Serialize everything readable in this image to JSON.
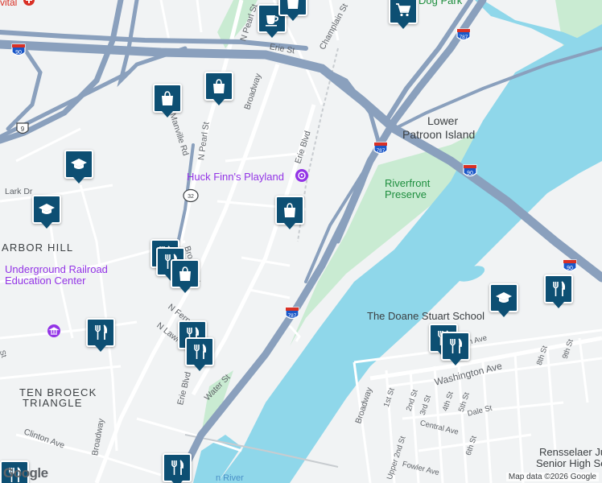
{
  "map": {
    "places": {
      "arbor_hill": "ARBOR HILL",
      "ten_broeck_1": "TEN BROECK",
      "ten_broeck_2": "TRIANGLE",
      "lower_patroon_1": "Lower",
      "lower_patroon_2": "Patroon Island"
    },
    "pois": {
      "huck_finn": "Huck Finn's Playland",
      "underground_1": "Underground Railroad",
      "underground_2": "Education Center",
      "riverfront_1": "Riverfront",
      "riverfront_2": "Preserve",
      "doane_stuart": "The Doane Stuart School",
      "rensselaer_1": "Rensselaer Junio",
      "rensselaer_2": "Senior High Schoo",
      "dog_park": "Dog Park",
      "hudson": "n River",
      "vital": "vital"
    },
    "streets": {
      "broadway_top": "Broadway",
      "broadway_mid": "Broadway",
      "broadway_left": "Broadway",
      "broadway_right": "Broadway",
      "n_pearl_top": "N Pearl St",
      "n_pearl_mid": "N Pearl St",
      "erie_top": "Erie St",
      "erie_blvd": "Erie Blvd",
      "erie_blvd_low": "Erie Blvd",
      "champlain": "Champlain St",
      "manville": "Manville Rd",
      "lark": "Lark Dr",
      "n_ferry": "N Ferry",
      "n_lawrence": "N Lawr",
      "water": "Water St",
      "clinton": "Clinton Ave",
      "washington": "Washington Ave",
      "first": "1st St",
      "second": "2nd St",
      "third": "3rd St",
      "fourth": "4th St",
      "fifth": "5th St",
      "sixth": "6th St",
      "eighth": "8th St",
      "ninth": "9th St",
      "dale": "Dale St",
      "central": "Central Ave",
      "upper_2nd": "Upper 2nd St",
      "fowler": "Fowler Ave",
      "ave_frag": "h Ave",
      "st_frag": "St",
      "broadway_small": "Broadway"
    },
    "shields": {
      "i787_a": "787",
      "i787_b": "787",
      "i787_c": "787",
      "i90_a": "90",
      "i90_b": "90",
      "i90_c": "90",
      "us9": "9",
      "r32": "32"
    },
    "footer": {
      "logo": "Google",
      "attribution": "Map data ©2026 Google"
    }
  },
  "markers": [
    {
      "name": "shopping-marker",
      "icon": "shopping-bag-icon"
    },
    {
      "name": "restaurant-marker",
      "icon": "fork-knife-icon"
    },
    {
      "name": "school-marker",
      "icon": "graduation-cap-icon"
    },
    {
      "name": "cafe-marker",
      "icon": "coffee-cup-icon"
    },
    {
      "name": "grocery-marker",
      "icon": "shopping-cart-icon"
    }
  ],
  "colors": {
    "land": "#f1f3f4",
    "water": "#8fd7ea",
    "park": "#c9ebd2",
    "highway": "#8aa0bd",
    "road": "#ffffff",
    "marker": "#0d4f73",
    "poi_purple": "#9334e6"
  }
}
